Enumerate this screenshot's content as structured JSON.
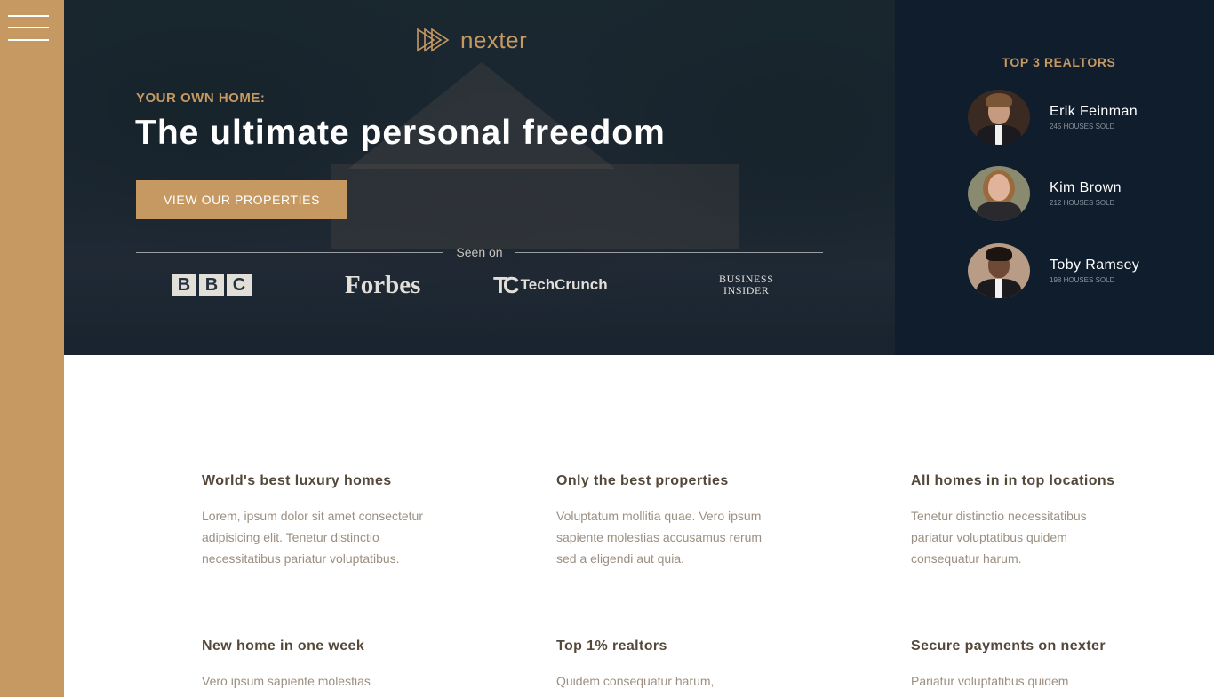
{
  "sidebar": {
    "menu_icon": "hamburger-menu-icon"
  },
  "hero": {
    "logo_text": "nexter",
    "subtitle": "Your own home:",
    "title": "The ultimate personal freedom",
    "button_label": "View our properties",
    "seen_on_label": "Seen on",
    "brands": [
      "BBC",
      "Forbes",
      "TechCrunch",
      "Business Insider"
    ],
    "bbc_letters": [
      "B",
      "B",
      "C"
    ],
    "techcrunch_mark": "TC",
    "business_insider_lines": [
      "Business",
      "Insider"
    ]
  },
  "realtors": {
    "title": "Top 3 realtors",
    "items": [
      {
        "name": "Erik Feinman",
        "sold": "245 houses sold"
      },
      {
        "name": "Kim Brown",
        "sold": "212 houses sold"
      },
      {
        "name": "Toby Ramsey",
        "sold": "198 houses sold"
      }
    ]
  },
  "features": [
    {
      "title": "World's best luxury homes",
      "text": "Lorem, ipsum dolor sit amet consectetur adipisicing elit. Tenetur distinctio necessitatibus pariatur voluptatibus."
    },
    {
      "title": "Only the best properties",
      "text": "Voluptatum mollitia quae. Vero ipsum sapiente molestias accusamus rerum sed a eligendi aut quia."
    },
    {
      "title": "All homes in in top locations",
      "text": "Tenetur distinctio necessitatibus pariatur voluptatibus quidem consequatur harum."
    },
    {
      "title": "New home in one week",
      "text": "Vero ipsum sapiente molestias"
    },
    {
      "title": "Top 1% realtors",
      "text": "Quidem consequatur harum,"
    },
    {
      "title": "Secure payments on nexter",
      "text": "Pariatur voluptatibus quidem"
    }
  ],
  "colors": {
    "accent": "#c69963",
    "dark": "#101d2c",
    "heading": "#54483a",
    "body_text": "#9c8f82"
  }
}
